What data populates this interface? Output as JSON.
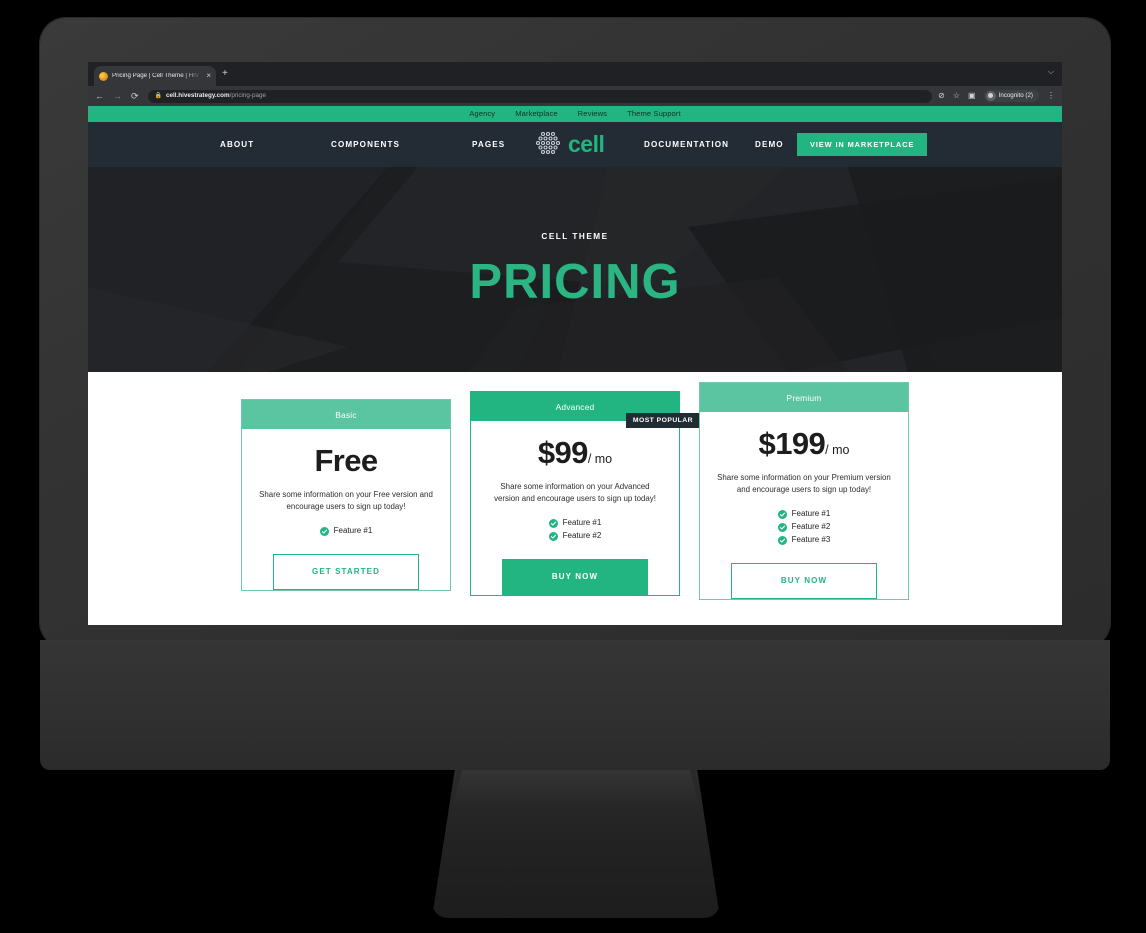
{
  "browser": {
    "tab_title": "Pricing Page | Cell Theme | HIV",
    "tab_close": "×",
    "new_tab": "+",
    "window_caret": "⌵",
    "back": "←",
    "forward": "→",
    "reload": "⟳",
    "lock": "🔒",
    "url_domain": "cell.hivestrategy.com",
    "url_path": "/pricing-page",
    "extension_icon": "⊘",
    "bookmark_icon": "☆",
    "sidepanel_icon": "▣",
    "profile_label": "Incognito (2)",
    "menu_icon": "⋮"
  },
  "topbar": {
    "links": [
      "Agency",
      "Marketplace",
      "Reviews",
      "Theme Support"
    ]
  },
  "nav": {
    "about": "ABOUT",
    "components": "COMPONENTS",
    "pages": "PAGES",
    "brand": "cell",
    "documentation": "DOCUMENTATION",
    "demo": "DEMO",
    "cta": "VIEW IN MARKETPLACE"
  },
  "hero": {
    "eyebrow": "CELL THEME",
    "title": "PRICING"
  },
  "pricing": {
    "cards": [
      {
        "name": "Basic",
        "price_amount": "Free",
        "price_period": "",
        "blurb": "Share some information on your Free version and encourage users to sign up today!",
        "features": [
          "Feature #1"
        ],
        "cta": "GET STARTED",
        "badge": ""
      },
      {
        "name": "Advanced",
        "price_amount": "$99",
        "price_period": "/ mo",
        "blurb": "Share some information on your Advanced version and encourage users to sign up today!",
        "features": [
          "Feature #1",
          "Feature #2"
        ],
        "cta": "BUY NOW",
        "badge": "MOST POPULAR"
      },
      {
        "name": "Premium",
        "price_amount": "$199",
        "price_period": "/ mo",
        "blurb": "Share some information on your Premium version and encourage users to sign up today!",
        "features": [
          "Feature #1",
          "Feature #2",
          "Feature #3"
        ],
        "cta": "BUY NOW",
        "badge": ""
      }
    ]
  },
  "colors": {
    "accent_green": "#22B581",
    "mint_green": "#5BC4A0",
    "nav_dark": "#232B35",
    "badge_dark": "#212B33",
    "hero_dark": "#1b1c1e"
  }
}
